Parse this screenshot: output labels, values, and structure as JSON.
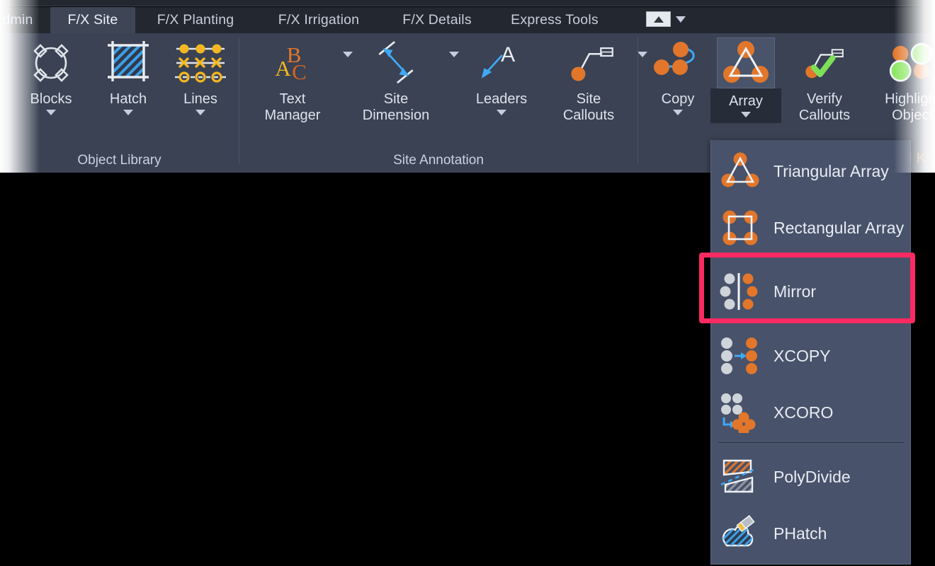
{
  "app": {
    "theme_bg": "#3a4253",
    "tabbar_bg": "#23272f",
    "accent_orange": "#e2762a",
    "highlight_color": "#fa2a63",
    "canvas_color": "#000000"
  },
  "tabbar": {
    "tabs": [
      {
        "label": "dmin",
        "active": false,
        "truncated": true
      },
      {
        "label": "F/X Site",
        "active": true
      },
      {
        "label": "F/X Planting",
        "active": false
      },
      {
        "label": "F/X Irrigation",
        "active": false
      },
      {
        "label": "F/X Details",
        "active": false
      },
      {
        "label": "Express Tools",
        "active": false
      }
    ],
    "minimize_ribbon": {
      "name": "minimize-ribbon-button",
      "arrow": "up-arrow-icon",
      "caret": "chevron-down-icon"
    }
  },
  "ribbon": {
    "panels": [
      {
        "label": "Object Library",
        "buttons": [
          {
            "label": "Blocks",
            "icon": "blocks-icon",
            "has_caret": true
          },
          {
            "label": "Hatch",
            "icon": "hatch-icon",
            "has_caret": true
          },
          {
            "label": "Lines",
            "icon": "lines-icon",
            "has_caret": true
          }
        ]
      },
      {
        "label": "Site Annotation",
        "buttons": [
          {
            "label": "Text\nManager",
            "line1": "Text",
            "line2": "Manager",
            "icon": "abc-text-icon",
            "has_caret": true
          },
          {
            "label": "Site\nDimension",
            "line1": "Site",
            "line2": "Dimension",
            "icon": "site-dimension-icon",
            "has_caret": true
          },
          {
            "label": "Leaders",
            "line1": "Leaders",
            "line2": "",
            "icon": "leader-arrow-icon",
            "has_caret": true
          },
          {
            "label": "Site\nCallouts",
            "line1": "Site",
            "line2": "Callouts",
            "icon": "site-callout-icon",
            "has_caret": true
          }
        ]
      },
      {
        "label": "l Ki",
        "label_truncated": true,
        "buttons": [
          {
            "label": "Copy",
            "line1": "Copy",
            "line2": "",
            "icon": "copy-arc-icon",
            "has_caret": true,
            "active": false
          },
          {
            "label": "Array",
            "line1": "Array",
            "line2": "",
            "icon": "triangular-array-icon",
            "has_caret": true,
            "active": true
          },
          {
            "label": "Verify\nCallouts",
            "line1": "Verify",
            "line2": "Callouts",
            "icon": "verify-check-icon",
            "has_caret": false,
            "active": false
          },
          {
            "label": "Highlight\nObject",
            "line1": "Highlight",
            "line2": "Object",
            "icon": "highlight-object-icon",
            "has_caret": false,
            "active": false
          }
        ]
      }
    ]
  },
  "dropdown": {
    "name": "array-dropdown-menu",
    "items": [
      {
        "label": "Triangular Array",
        "icon": "triangular-array-icon",
        "highlighted": false
      },
      {
        "label": "Rectangular Array",
        "icon": "rectangular-array-icon",
        "highlighted": false
      },
      {
        "label": "Mirror",
        "icon": "mirror-icon",
        "highlighted": true
      },
      {
        "label": "XCOPY",
        "icon": "xcopy-icon",
        "highlighted": false
      },
      {
        "label": "XCORO",
        "icon": "xcoro-icon",
        "highlighted": false
      },
      {
        "label": "PolyDivide",
        "icon": "polydivide-icon",
        "highlighted": false
      },
      {
        "label": "PHatch",
        "icon": "phatch-icon",
        "highlighted": false
      }
    ]
  }
}
